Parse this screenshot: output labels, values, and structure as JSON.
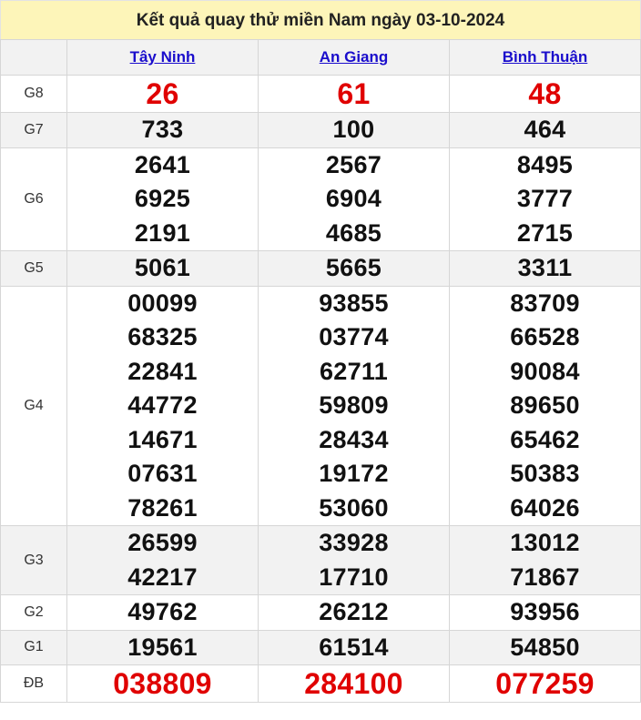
{
  "title": "Kết quả quay thử miền Nam ngày 03-10-2024",
  "provinces": [
    "Tây Ninh",
    "An Giang",
    "Bình Thuận"
  ],
  "prizes": [
    {
      "label": "G8",
      "values": [
        [
          "26"
        ],
        [
          "61"
        ],
        [
          "48"
        ]
      ]
    },
    {
      "label": "G7",
      "values": [
        [
          "733"
        ],
        [
          "100"
        ],
        [
          "464"
        ]
      ]
    },
    {
      "label": "G6",
      "values": [
        [
          "2641",
          "6925",
          "2191"
        ],
        [
          "2567",
          "6904",
          "4685"
        ],
        [
          "8495",
          "3777",
          "2715"
        ]
      ]
    },
    {
      "label": "G5",
      "values": [
        [
          "5061"
        ],
        [
          "5665"
        ],
        [
          "3311"
        ]
      ]
    },
    {
      "label": "G4",
      "values": [
        [
          "00099",
          "68325",
          "22841",
          "44772",
          "14671",
          "07631",
          "78261"
        ],
        [
          "93855",
          "03774",
          "62711",
          "59809",
          "28434",
          "19172",
          "53060"
        ],
        [
          "83709",
          "66528",
          "90084",
          "89650",
          "65462",
          "50383",
          "64026"
        ]
      ]
    },
    {
      "label": "G3",
      "values": [
        [
          "26599",
          "42217"
        ],
        [
          "33928",
          "17710"
        ],
        [
          "13012",
          "71867"
        ]
      ]
    },
    {
      "label": "G2",
      "values": [
        [
          "49762"
        ],
        [
          "26212"
        ],
        [
          "93956"
        ]
      ]
    },
    {
      "label": "G1",
      "values": [
        [
          "19561"
        ],
        [
          "61514"
        ],
        [
          "54850"
        ]
      ]
    },
    {
      "label": "ĐB",
      "values": [
        [
          "038809"
        ],
        [
          "284100"
        ],
        [
          "077259"
        ]
      ]
    }
  ]
}
